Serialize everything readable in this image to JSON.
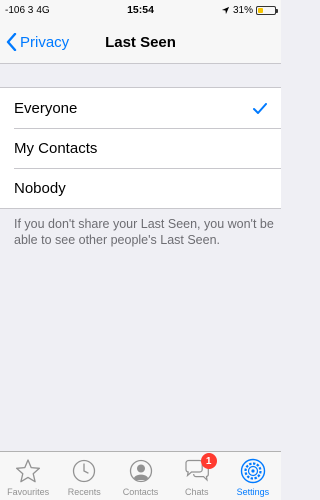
{
  "status_bar": {
    "carrier": "-106 3",
    "network": "4G",
    "time": "15:54",
    "battery_percent": "31%",
    "battery_level": 0.31
  },
  "nav": {
    "back_label": "Privacy",
    "title": "Last Seen"
  },
  "options": [
    {
      "label": "Everyone",
      "selected": true
    },
    {
      "label": "My Contacts",
      "selected": false
    },
    {
      "label": "Nobody",
      "selected": false
    }
  ],
  "footnote": "If you don't share your Last Seen, you won't be able to see other people's Last Seen.",
  "tabs": [
    {
      "label": "Favourites",
      "icon": "star-icon",
      "active": false
    },
    {
      "label": "Recents",
      "icon": "clock-icon",
      "active": false
    },
    {
      "label": "Contacts",
      "icon": "contact-icon",
      "active": false
    },
    {
      "label": "Chats",
      "icon": "chat-bubbles-icon",
      "active": false,
      "badge": "1"
    },
    {
      "label": "Settings",
      "icon": "gear-icon",
      "active": true
    }
  ],
  "colors": {
    "accent": "#007aff",
    "background": "#efeff4",
    "badge": "#ff3b30",
    "battery": "#f5c400"
  }
}
